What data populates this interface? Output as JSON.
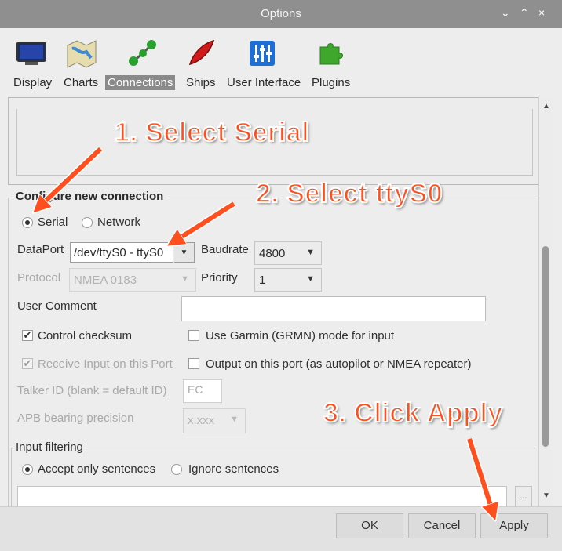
{
  "window": {
    "title": "Options",
    "controls": [
      "⌄",
      "⌃",
      "×"
    ]
  },
  "toolbar": {
    "tabs": [
      {
        "label": "Display",
        "icon": "monitor-icon"
      },
      {
        "label": "Charts",
        "icon": "map-icon"
      },
      {
        "label": "Connections",
        "icon": "connections-icon",
        "active": true
      },
      {
        "label": "Ships",
        "icon": "ship-icon"
      },
      {
        "label": "User Interface",
        "icon": "sliders-icon"
      },
      {
        "label": "Plugins",
        "icon": "puzzle-icon"
      }
    ]
  },
  "connection": {
    "group_title": "Configure new connection",
    "type_serial": "Serial",
    "type_network": "Network",
    "selected_type": "Serial",
    "dataport_label": "DataPort",
    "dataport_value": "/dev/ttyS0 - ttyS0",
    "baudrate_label": "Baudrate",
    "baudrate_value": "4800",
    "protocol_label": "Protocol",
    "protocol_value": "NMEA 0183",
    "priority_label": "Priority",
    "priority_value": "1",
    "user_comment_label": "User Comment",
    "user_comment_value": "",
    "control_checksum": "Control checksum",
    "control_checksum_checked": true,
    "use_garmin": "Use Garmin (GRMN) mode for input",
    "use_garmin_checked": false,
    "receive_input": "Receive Input on this Port",
    "receive_input_checked": true,
    "output_port": "Output on this port (as autopilot or NMEA repeater)",
    "output_port_checked": false,
    "talker_label": "Talker ID (blank = default ID)",
    "talker_value": "EC",
    "apb_label": "APB bearing precision",
    "apb_value": "x.xxx",
    "input_filtering": "Input filtering",
    "accept_only": "Accept only sentences",
    "ignore": "Ignore sentences",
    "filter_button": "..."
  },
  "buttons": {
    "ok": "OK",
    "cancel": "Cancel",
    "apply": "Apply"
  },
  "annotations": {
    "step1": "1. Select Serial",
    "step2": "2. Select ttyS0",
    "step3": "3. Click Apply"
  },
  "colors": {
    "annotation": "#ff4f1f",
    "active_tab": "#8a8a8a",
    "titlebar": "#8f8f8f"
  }
}
